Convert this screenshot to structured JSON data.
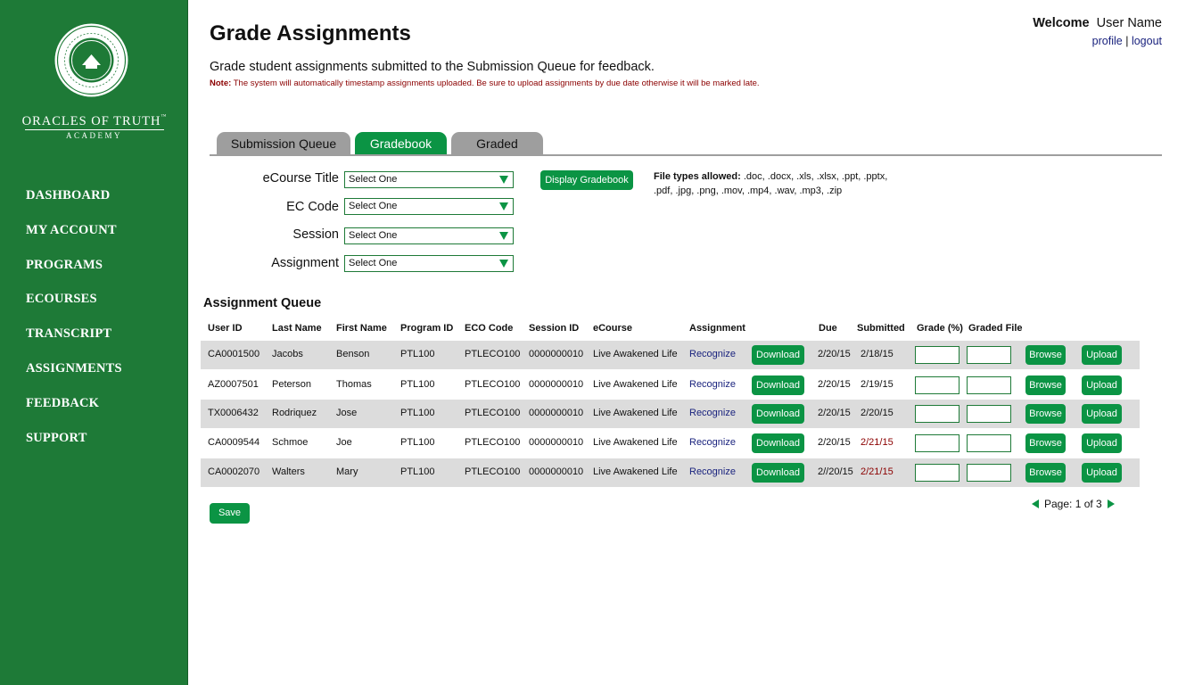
{
  "brand": {
    "name": "ORACLES OF TRUTH",
    "tm": "™",
    "sub": "ACADEMY",
    "seal_icon": "academy-seal-icon"
  },
  "nav": [
    "DASHBOARD",
    "MY ACCOUNT",
    "PROGRAMS",
    "ECOURSES",
    "TRANSCRIPT",
    "ASSIGNMENTS",
    "FEEDBACK",
    "SUPPORT"
  ],
  "header": {
    "title": "Grade Assignments",
    "description": "Grade student assignments submitted to the Submission Queue for feedback.",
    "note_label": "Note:",
    "note_text": " The system will automatically timestamp assignments uploaded. Be sure to upload assignments by due date otherwise it will be marked late.",
    "welcome": "Welcome",
    "user_name": "User Name",
    "profile": "profile",
    "separator": "|",
    "logout": "logout"
  },
  "tabs": [
    "Submission Queue",
    "Gradebook",
    "Graded"
  ],
  "active_tab": "Gradebook",
  "filters": {
    "course_label": "eCourse Title",
    "code_label": "EC Code",
    "session_label": "Session",
    "assignment_label": "Assignment",
    "select_value": "Select One",
    "display_button": "Display Gradebook",
    "filetypes_label": "File types allowed:",
    "filetypes_text": " .doc, .docx, .xls, .xlsx, .ppt, .pptx, .pdf, .jpg, .png, .mov, .mp4, .wav, .mp3, .zip"
  },
  "queue": {
    "title": "Assignment Queue",
    "columns": [
      "User ID",
      "Last Name",
      "First Name",
      "Program ID",
      "ECO Code",
      "Session ID",
      "eCourse",
      "Assignment",
      "Due",
      "Submitted",
      "Grade (%)",
      "Graded File"
    ],
    "download_label": "Download",
    "browse_label": "Browse",
    "upload_label": "Upload",
    "rows": [
      {
        "user_id": "CA0001500",
        "last": "Jacobs",
        "first": "Benson",
        "program": "PTL100",
        "eco": "PTLECO100",
        "session": "0000000010",
        "course": "Live Awakened Life",
        "assignment": "Recognize",
        "due": "2/20/15",
        "submitted": "2/18/15",
        "late": false
      },
      {
        "user_id": "AZ0007501",
        "last": "Peterson",
        "first": "Thomas",
        "program": "PTL100",
        "eco": "PTLECO100",
        "session": "0000000010",
        "course": "Live Awakened Life",
        "assignment": "Recognize",
        "due": "2/20/15",
        "submitted": "2/19/15",
        "late": false
      },
      {
        "user_id": "TX0006432",
        "last": "Rodriquez",
        "first": "Jose",
        "program": "PTL100",
        "eco": "PTLECO100",
        "session": "0000000010",
        "course": "Live Awakened Life",
        "assignment": "Recognize",
        "due": "2/20/15",
        "submitted": "2/20/15",
        "late": false
      },
      {
        "user_id": "CA0009544",
        "last": "Schmoe",
        "first": "Joe",
        "program": "PTL100",
        "eco": "PTLECO100",
        "session": "0000000010",
        "course": "Live Awakened Life",
        "assignment": "Recognize",
        "due": "2/20/15",
        "submitted": "2/21/15",
        "late": true
      },
      {
        "user_id": "CA0002070",
        "last": "Walters",
        "first": "Mary",
        "program": "PTL100",
        "eco": "PTLECO100",
        "session": "0000000010",
        "course": "Live Awakened Life",
        "assignment": "Recognize",
        "due": "2//20/15",
        "submitted": "2/21/15",
        "late": true
      }
    ]
  },
  "save_label": "Save",
  "pager": {
    "text": "Page: 1 of 3",
    "prev_icon": "prev-page-icon",
    "next_icon": "next-page-icon"
  },
  "colors": {
    "sidebar": "#1e7a37",
    "accent": "#0b9444",
    "late": "#8b0000",
    "link": "#1a237e",
    "row_shade": "#dcdcdc"
  }
}
